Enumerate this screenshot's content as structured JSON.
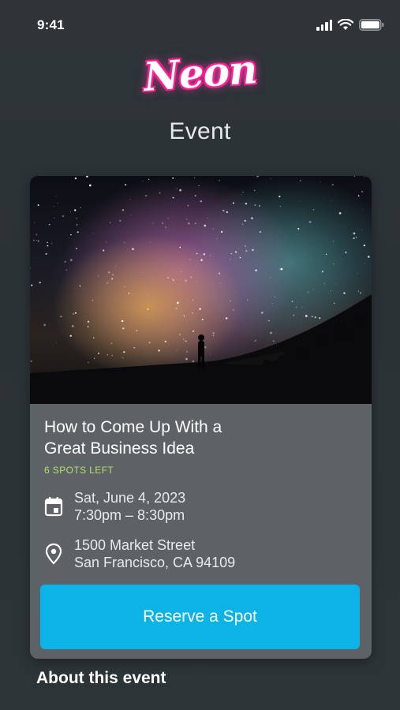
{
  "status_bar": {
    "time": "9:41",
    "icons": [
      "signal-icon",
      "wifi-icon",
      "battery-icon"
    ]
  },
  "logo": {
    "text": "Neon",
    "color": "#ff2fa0"
  },
  "page": {
    "title": "Event"
  },
  "event": {
    "title_line1": "How to Come Up With a",
    "title_line2": "Great Business Idea",
    "spots_left": "6 SPOTS LEFT",
    "date": "Sat, June 4, 2023",
    "time": "7:30pm – 8:30pm",
    "address_line1": "1500 Market Street",
    "address_line2": "San Francisco, CA 94109",
    "reserve_label": "Reserve a Spot",
    "accent_color": "#0bb3e6",
    "spots_color": "#b5e06a"
  },
  "about": {
    "title": "About this event",
    "text": ""
  }
}
